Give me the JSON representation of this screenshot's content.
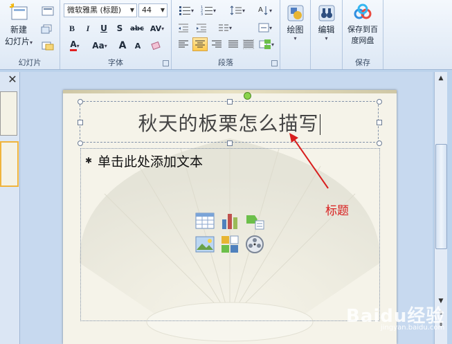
{
  "ribbon": {
    "slides_group": {
      "label": "幻灯片",
      "new_slide_line1": "新建",
      "new_slide_line2": "幻灯片",
      "dropdown_glyph": "▾"
    },
    "font_group": {
      "label": "字体",
      "font_name": "微软雅黑 (标题)",
      "font_size": "44",
      "bold": "B",
      "italic": "I",
      "underline": "U",
      "shadow": "S",
      "strike": "abc",
      "spacing": "AV",
      "color": "A",
      "case": "Aa",
      "grow": "A",
      "shrink": "A"
    },
    "paragraph_group": {
      "label": "段落"
    },
    "drawing_group": {
      "label": "绘图"
    },
    "editing_group": {
      "label": "编辑"
    },
    "save_group": {
      "label": "保存",
      "button_line1": "保存到百",
      "button_line2": "度网盘"
    },
    "colors": {
      "font_color": "#e02020",
      "active_highlight": "#ffc94d"
    }
  },
  "panes": {
    "close_glyph": "✕"
  },
  "slide": {
    "title": "秋天的板栗怎么描写",
    "content_placeholder": "单击此处添加文本",
    "bullet": "✱"
  },
  "annotation": {
    "label": "标题",
    "color": "#d81e1e"
  },
  "scrollbar": {
    "up": "▲",
    "down": "▼",
    "prev": "⇞",
    "next": "⇟"
  },
  "watermark": {
    "brand": "Baidu经验",
    "sub": "jingyan.baidu.com"
  }
}
